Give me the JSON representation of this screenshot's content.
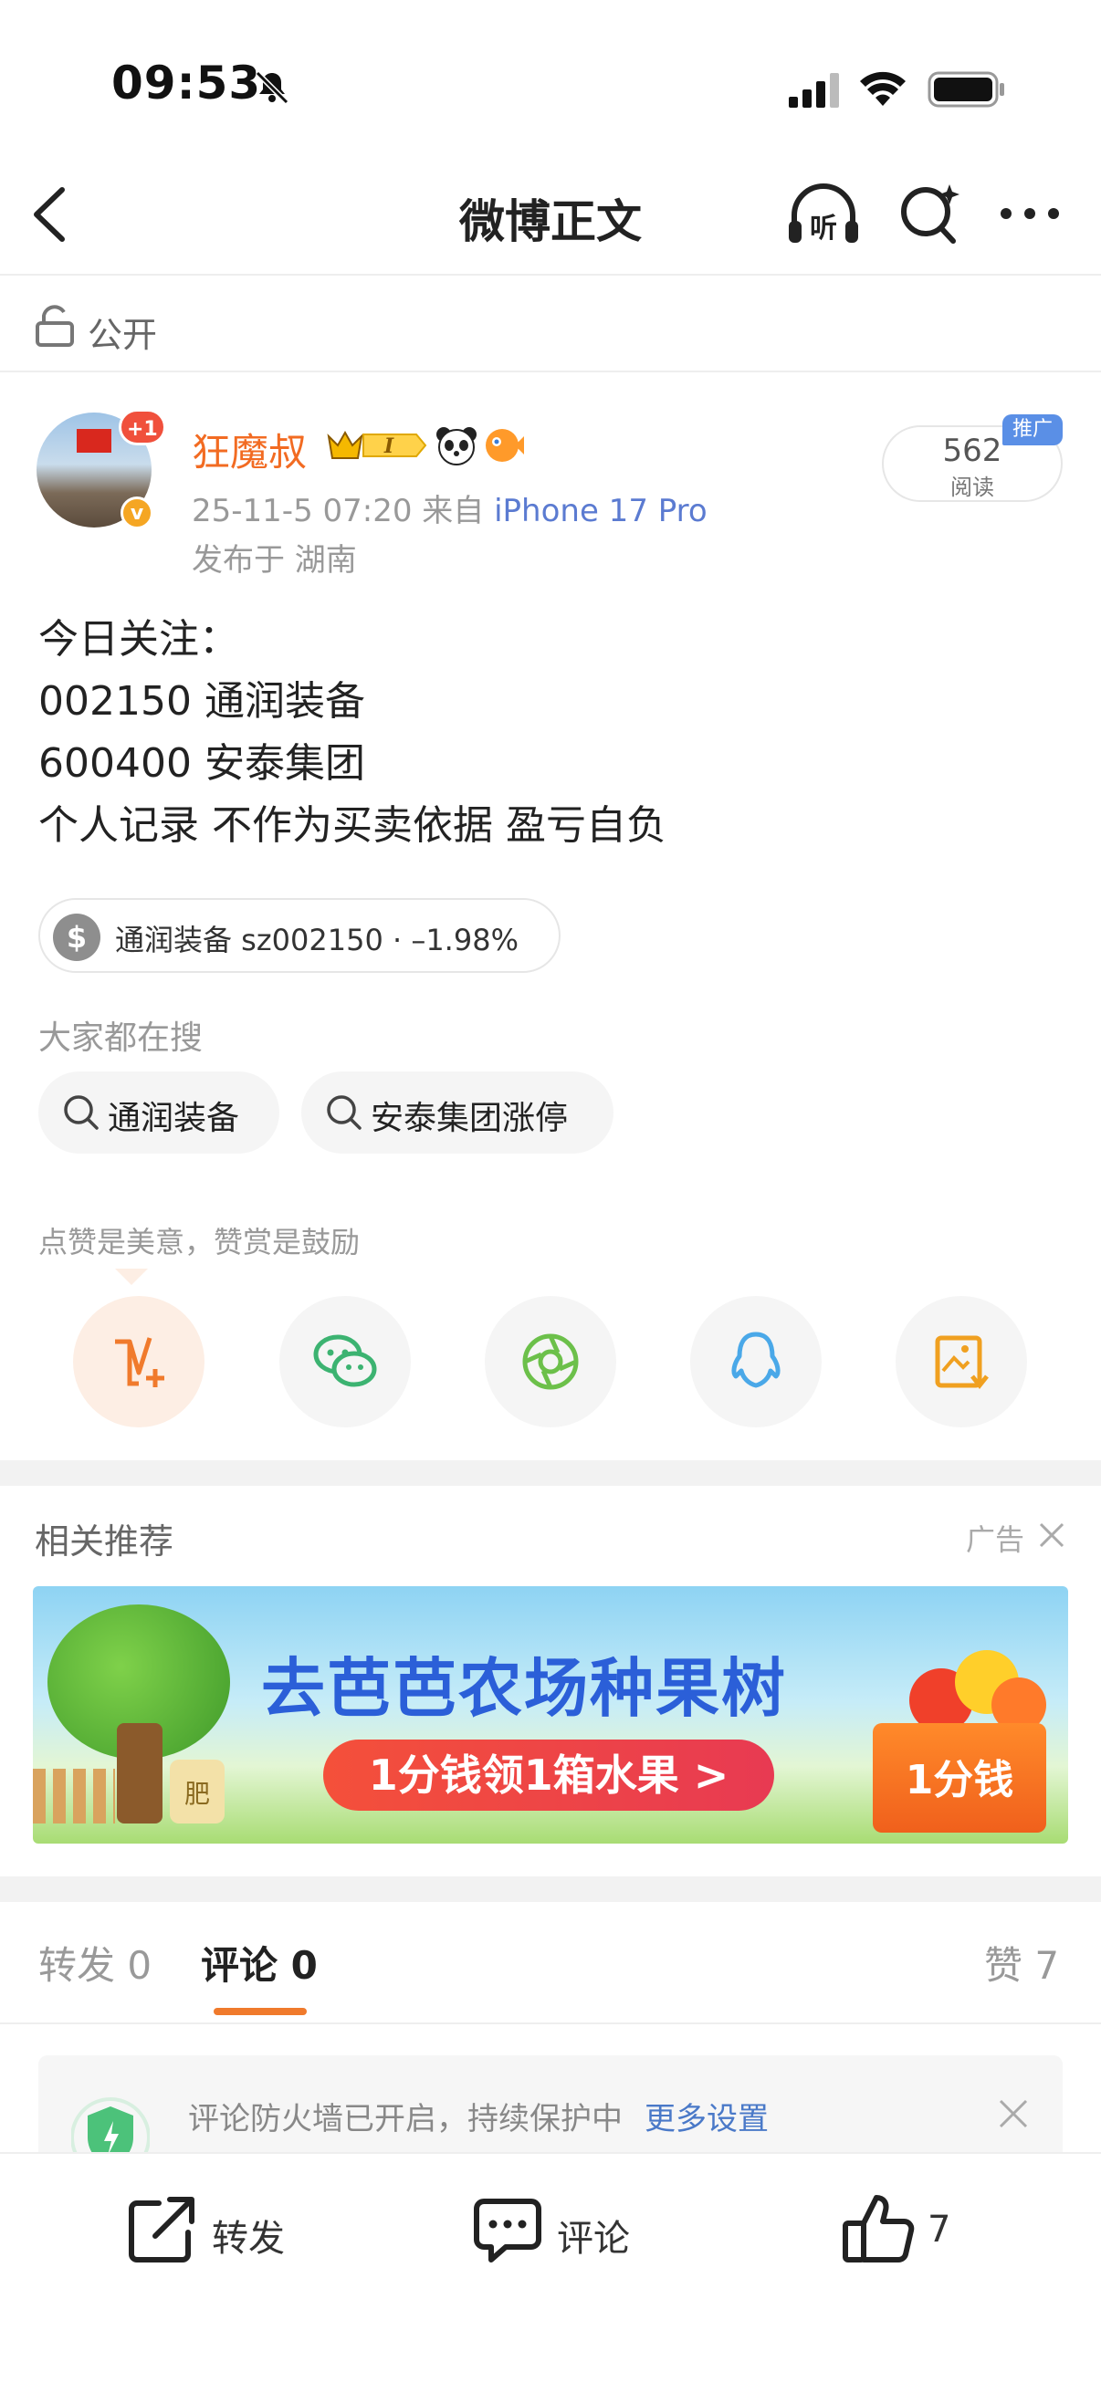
{
  "status_bar": {
    "time": "09:53"
  },
  "nav": {
    "title": "微博正文"
  },
  "visibility": "公开",
  "author": {
    "name": "狂魔叔",
    "badge_plus": "+1",
    "post_time": "25-11-5 07:20  来自",
    "source": "iPhone 17 Pro",
    "location": "发布于 湖南",
    "read_count": "562",
    "read_label": "阅读",
    "promo_tag": "推广"
  },
  "content": {
    "lines": [
      "今日关注：",
      "002150 通润装备",
      "600400 安泰集团",
      "个人记录 不作为买卖依据 盈亏自负"
    ]
  },
  "stock_chip": {
    "icon": "$",
    "label": "通润装备 sz002150 · –1.98%"
  },
  "hot_search": {
    "label": "大家都在搜",
    "items": [
      "通润装备",
      "安泰集团涨停"
    ]
  },
  "praise_hint": "点赞是美意，赞赏是鼓励",
  "share_icons": [
    "weibo-v-plus-icon",
    "wechat-icon",
    "moments-icon",
    "qq-icon",
    "save-image-icon"
  ],
  "recommend": {
    "label": "相关推荐",
    "ad_label": "广告",
    "banner_title": "去芭芭农场种果树",
    "banner_cta": "1分钱领1箱水果 >",
    "banner_box": "1分钱",
    "bag_text": "肥"
  },
  "tabs": {
    "repost": "转发 0",
    "comment": "评论 0",
    "like": "赞 7"
  },
  "notice": {
    "text": "评论防火墙已开启，持续保护中",
    "link": "更多设置"
  },
  "toolbar": {
    "repost": "转发",
    "comment": "评论",
    "like": "7"
  },
  "colors": {
    "accent": "#f07a2c",
    "author_name": "#f26b22",
    "link": "#4a79c8",
    "promo": "#5a8fe6"
  }
}
